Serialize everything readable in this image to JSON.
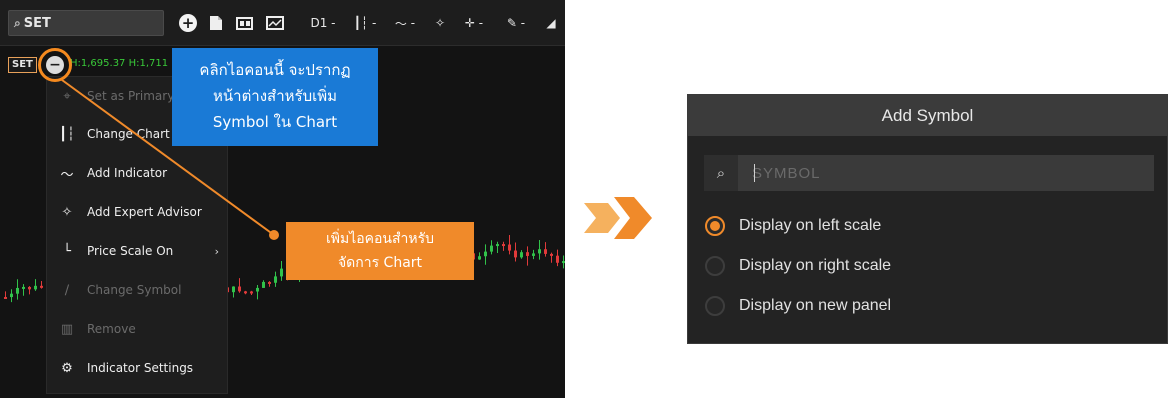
{
  "colors": {
    "accent_orange": "#f08a2a",
    "callout_blue": "#1a7ad6",
    "candle_up": "#31c24a",
    "candle_down": "#e03a3a"
  },
  "toolbar": {
    "symbol_value": "SET",
    "timeframe_label": "D1 -",
    "icons": [
      "search-icon",
      "add-symbol-icon",
      "new-file-icon",
      "template-icon",
      "chart-window-icon",
      "candle-style-icon",
      "indicator-icon",
      "expert-advisor-icon",
      "crosshair-icon",
      "draw-pen-icon"
    ]
  },
  "chart": {
    "symbol_tag": "SET",
    "ohlc_text": "H:1,695.37 H:1,711"
  },
  "menu": {
    "items": [
      {
        "label": "Set as Primary",
        "icon": "pin-icon",
        "disabled": true
      },
      {
        "label": "Change Chart",
        "icon": "candle-style-icon",
        "disabled": false
      },
      {
        "label": "Add Indicator",
        "icon": "indicator-icon",
        "disabled": false
      },
      {
        "label": "Add Expert Advisor",
        "icon": "expert-advisor-icon",
        "disabled": false
      },
      {
        "label": "Price Scale On",
        "icon": "price-scale-icon",
        "disabled": false,
        "submenu": true
      },
      {
        "label": "Change Symbol",
        "icon": "edit-icon",
        "disabled": true
      },
      {
        "label": "Remove",
        "icon": "trash-icon",
        "disabled": true
      },
      {
        "label": "Indicator Settings",
        "icon": "gear-icon",
        "disabled": false
      }
    ]
  },
  "callouts": {
    "blue_lines": [
      "คลิกไอคอนนี้ จะปรากฏ",
      "หน้าต่างสำหรับเพิ่ม",
      "Symbol ใน Chart"
    ],
    "orange_lines": [
      "เพิ่มไอคอนสำหรับ",
      "จัดการ Chart"
    ]
  },
  "dialog": {
    "title": "Add Symbol",
    "search_placeholder": "SYMBOL",
    "options": [
      {
        "label": "Display on left scale",
        "selected": true
      },
      {
        "label": "Display on right scale",
        "selected": false
      },
      {
        "label": "Display on new panel",
        "selected": false
      }
    ]
  }
}
